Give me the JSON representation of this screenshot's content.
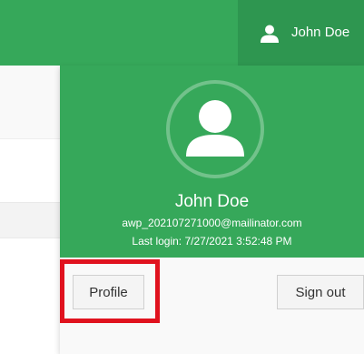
{
  "header": {
    "user_name": "John Doe",
    "user_icon": "user-icon"
  },
  "dropdown": {
    "avatar_icon": "user-avatar-icon",
    "name": "John Doe",
    "email": "awp_202107271000@mailinator.com",
    "last_login": "Last login: 7/27/2021 3:52:48 PM",
    "profile_label": "Profile",
    "signout_label": "Sign out"
  },
  "colors": {
    "brand_green": "#36a85a",
    "highlight_red": "#e0121e"
  }
}
